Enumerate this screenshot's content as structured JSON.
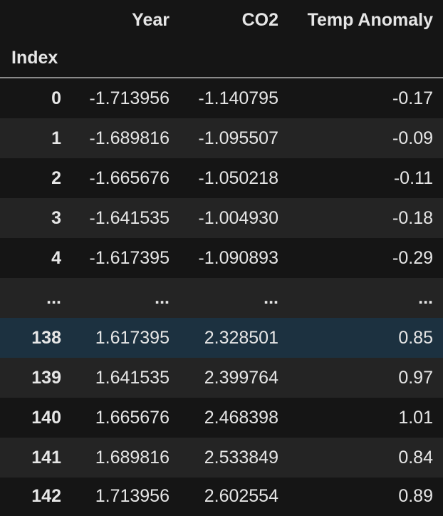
{
  "table": {
    "columns": [
      "Year",
      "CO2",
      "Temp Anomaly"
    ],
    "index_name": "Index",
    "rows": [
      {
        "index": "0",
        "year": "-1.713956",
        "co2": "-1.140795",
        "temp": "-0.17"
      },
      {
        "index": "1",
        "year": "-1.689816",
        "co2": "-1.095507",
        "temp": "-0.09"
      },
      {
        "index": "2",
        "year": "-1.665676",
        "co2": "-1.050218",
        "temp": "-0.11"
      },
      {
        "index": "3",
        "year": "-1.641535",
        "co2": "-1.004930",
        "temp": "-0.18"
      },
      {
        "index": "4",
        "year": "-1.617395",
        "co2": "-1.090893",
        "temp": "-0.29"
      },
      {
        "index": "...",
        "year": "...",
        "co2": "...",
        "temp": "..."
      },
      {
        "index": "138",
        "year": "1.617395",
        "co2": "2.328501",
        "temp": "0.85"
      },
      {
        "index": "139",
        "year": "1.641535",
        "co2": "2.399764",
        "temp": "0.97"
      },
      {
        "index": "140",
        "year": "1.665676",
        "co2": "2.468398",
        "temp": "1.01"
      },
      {
        "index": "141",
        "year": "1.689816",
        "co2": "2.533849",
        "temp": "0.84"
      },
      {
        "index": "142",
        "year": "1.713956",
        "co2": "2.602554",
        "temp": "0.89"
      }
    ]
  },
  "colors": {
    "background": "#151515",
    "stripe": "#242424",
    "hover_highlight": "#1c3140",
    "text": "#e6e6e6"
  }
}
